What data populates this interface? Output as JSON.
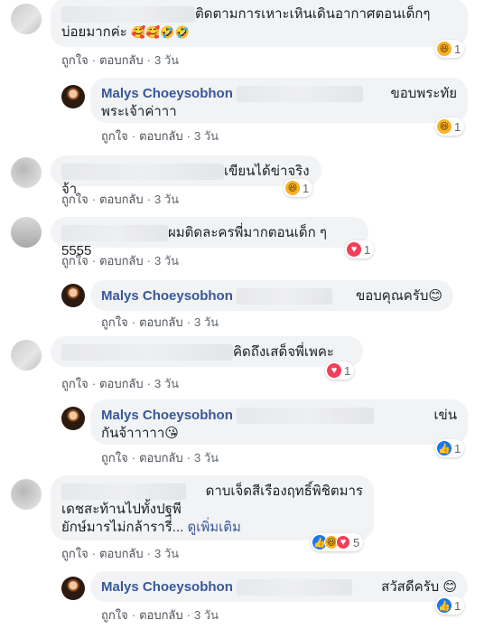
{
  "actions": {
    "like": "ถูกใจ",
    "reply": "ตอบกลับ",
    "time": "3 วัน",
    "sep": "·"
  },
  "comments": [
    {
      "line1": "ติดตามการเหาะเหินเดินอากาศตอนเด็กๆ",
      "line2": "บ่อยมากค่ะ",
      "emojis": "🥰🥰🤣🤣",
      "reaction": {
        "icons": [
          "haha-icon"
        ],
        "count": "1"
      }
    },
    {
      "name": "Malys Choeysobhon",
      "line1": "ขอบพระทัย",
      "line2": "พระเจ้าค่าาา",
      "reaction": {
        "icons": [
          "haha-icon"
        ],
        "count": "1"
      }
    },
    {
      "line1": "เขียนได้ข่าจริงจ้า",
      "reaction": {
        "icons": [
          "haha-icon"
        ],
        "count": "1"
      }
    },
    {
      "line1": "ผมติดละครพี่มากตอนเด็ก ๆ 5555",
      "reaction": {
        "icons": [
          "love-icon"
        ],
        "count": "1"
      }
    },
    {
      "name": "Malys Choeysobhon",
      "line1": "ขอบคุณครับ😊"
    },
    {
      "line1": "คิดถึงเสด็จพี่เพคะ",
      "reaction": {
        "icons": [
          "love-icon"
        ],
        "count": "1"
      }
    },
    {
      "name": "Malys Choeysobhon",
      "line1": "เข่น",
      "line2": "กันจ้าาาาา😘",
      "reaction": {
        "icons": [
          "like-icon"
        ],
        "count": "1"
      }
    },
    {
      "line1": "ดาบเจ็ดสีเรืองฤทธิ์พิชิตมาร",
      "line2": "เดชสะท้านไปทั้งปฐพี",
      "line3": "ยักษ์มารไม่กล้ารารี่...",
      "more": "ดูเพิ่มเติม",
      "reaction": {
        "icons": [
          "like-icon",
          "haha-icon",
          "love-icon"
        ],
        "count": "5"
      }
    },
    {
      "name": "Malys Choeysobhon",
      "line1": "สวัสดีครับ 😊",
      "reaction": {
        "icons": [
          "like-icon"
        ],
        "count": "1"
      }
    }
  ]
}
